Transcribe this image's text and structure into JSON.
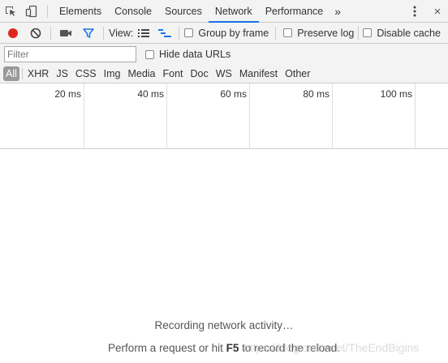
{
  "tabs": [
    {
      "label": "Elements"
    },
    {
      "label": "Console"
    },
    {
      "label": "Sources"
    },
    {
      "label": "Network"
    },
    {
      "label": "Performance"
    }
  ],
  "active_tab": "Network",
  "more_tabs_glyph": "»",
  "close_glyph": "×",
  "toolbar": {
    "view_label": "View:",
    "group_by_frame": {
      "label": "Group by frame",
      "checked": false
    },
    "preserve_log": {
      "label": "Preserve log",
      "checked": false
    },
    "disable_cache": {
      "label": "Disable cache",
      "checked": false
    },
    "record_color": "#e0271f",
    "filter_icon_color": "#1a73e8"
  },
  "filter": {
    "placeholder": "Filter",
    "value": "",
    "hide_data_urls": {
      "label": "Hide data URLs",
      "checked": false
    }
  },
  "types": [
    "All",
    "XHR",
    "JS",
    "CSS",
    "Img",
    "Media",
    "Font",
    "Doc",
    "WS",
    "Manifest",
    "Other"
  ],
  "active_type": "All",
  "timeline": {
    "ticks": [
      "20 ms",
      "40 ms",
      "60 ms",
      "80 ms",
      "100 ms"
    ]
  },
  "empty_state": {
    "recording": "Recording network activity…",
    "hint_prefix": "Perform a request or hit ",
    "hint_key": "F5",
    "hint_suffix": " to record the reload.",
    "watermark": "https://blog.csdn.net/TheEndBigins"
  }
}
